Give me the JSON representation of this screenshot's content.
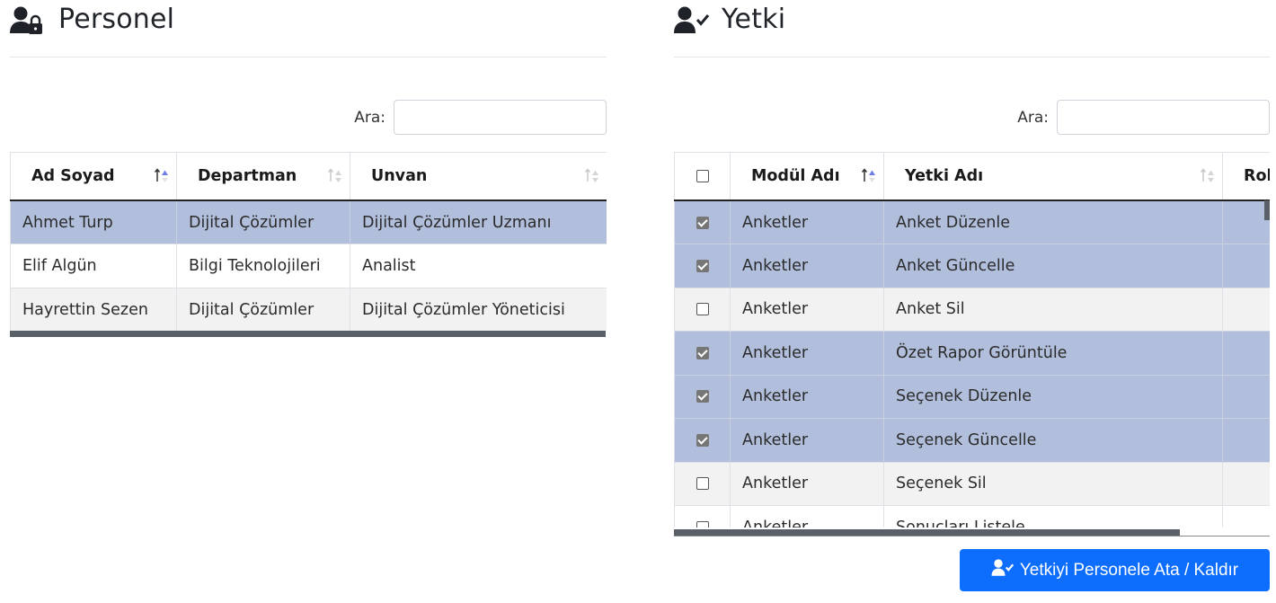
{
  "personel": {
    "title": "Personel",
    "header_icon": "user-lock-icon",
    "search_label": "Ara:",
    "search_value": "",
    "columns": [
      "Ad Soyad",
      "Departman",
      "Unvan"
    ],
    "rows": [
      [
        "Ahmet Turp",
        "Dijital Çözümler",
        "Dijital Çözümler Uzmanı"
      ],
      [
        "Elif Algün",
        "Bilgi Teknolojileri",
        "Analist"
      ],
      [
        "Hayrettin Sezen",
        "Dijital Çözümler",
        "Dijital Çözümler Yöneticisi"
      ]
    ],
    "selected_row": 0
  },
  "yetki": {
    "title": "Yetki",
    "header_icon": "user-check-icon",
    "search_label": "Ara:",
    "search_value": "",
    "columns": [
      "Modül Adı",
      "Yetki Adı",
      "Rol"
    ],
    "rows": [
      {
        "checked": true,
        "modul": "Anketler",
        "yetki": "Anket Düzenle"
      },
      {
        "checked": true,
        "modul": "Anketler",
        "yetki": "Anket Güncelle"
      },
      {
        "checked": false,
        "modul": "Anketler",
        "yetki": "Anket Sil"
      },
      {
        "checked": true,
        "modul": "Anketler",
        "yetki": "Özet Rapor Görüntüle"
      },
      {
        "checked": true,
        "modul": "Anketler",
        "yetki": "Seçenek Düzenle"
      },
      {
        "checked": true,
        "modul": "Anketler",
        "yetki": "Seçenek Güncelle"
      },
      {
        "checked": false,
        "modul": "Anketler",
        "yetki": "Seçenek Sil"
      },
      {
        "checked": false,
        "modul": "Anketler",
        "yetki": "Sonuçları Listele"
      }
    ]
  },
  "assign_button": {
    "label": "Yetkiyi Personele Ata / Kaldır",
    "icon": "user-check-icon"
  },
  "colors": {
    "selected_row": "#b1bfdc",
    "odd_row": "#f2f2f2",
    "primary": "#0d6efd",
    "sort_active": "#6f7ee6"
  }
}
